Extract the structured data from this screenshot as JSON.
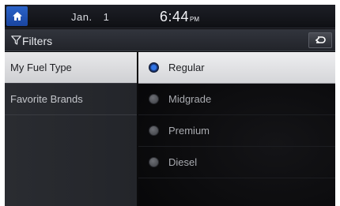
{
  "statusbar": {
    "home_icon": "home-icon",
    "month": "Jan.",
    "day": "1",
    "time": "6:44",
    "ampm": "PM"
  },
  "header": {
    "filter_icon": "filter-icon",
    "title": "Filters",
    "back_icon": "back-arrow-icon"
  },
  "sidebar": {
    "items": [
      {
        "label": "My Fuel Type",
        "active": true
      },
      {
        "label": "Favorite Brands",
        "active": false
      }
    ]
  },
  "fuel_options": {
    "selected": "Regular",
    "items": [
      {
        "label": "Regular"
      },
      {
        "label": "Midgrade"
      },
      {
        "label": "Premium"
      },
      {
        "label": "Diesel"
      }
    ]
  },
  "colors": {
    "accent_blue": "#2a63c9",
    "selected_row": "#e8e8ea",
    "background": "#0b0b0d"
  }
}
